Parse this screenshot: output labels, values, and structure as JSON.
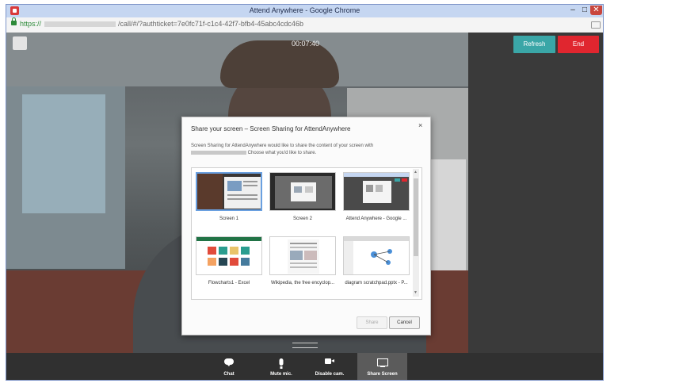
{
  "window": {
    "title": "Attend Anywhere - Google Chrome",
    "controls": {
      "minimize": "–",
      "maximize": "□",
      "close": "✕"
    }
  },
  "address_bar": {
    "scheme": "https://",
    "path": "/call/#/?authticket=7e0fc71f-c1c4-42f7-bfb4-45abc4cdc46b"
  },
  "call": {
    "timer": "00:07:40",
    "refresh_label": "Refresh",
    "end_label": "End"
  },
  "toolbar": {
    "items": [
      {
        "label": "Chat",
        "icon": "chat-icon"
      },
      {
        "label": "Mute mic.",
        "icon": "microphone-icon"
      },
      {
        "label": "Disable cam.",
        "icon": "camera-icon"
      },
      {
        "label": "Share Screen",
        "icon": "monitor-icon",
        "active": true
      }
    ]
  },
  "dialog": {
    "title": "Share your screen – Screen Sharing for AttendAnywhere",
    "desc_part1": "Screen Sharing for AttendAnywhere would like to share the content of your screen with",
    "desc_part2": "Choose what you'd like to share.",
    "close": "×",
    "sources": [
      {
        "label": "Screen 1",
        "selected": true
      },
      {
        "label": "Screen 2"
      },
      {
        "label": "Attend Anywhere - Google ..."
      },
      {
        "label": "Flowcharts1 - Excel"
      },
      {
        "label": "Wikipedia, the free encyclop..."
      },
      {
        "label": "diagram scratchpad.pptx - P..."
      }
    ],
    "share_label": "Share",
    "cancel_label": "Cancel"
  },
  "colors": {
    "refresh": "#3aa6a7",
    "end": "#e0262f",
    "selection": "#6aa0e0"
  }
}
